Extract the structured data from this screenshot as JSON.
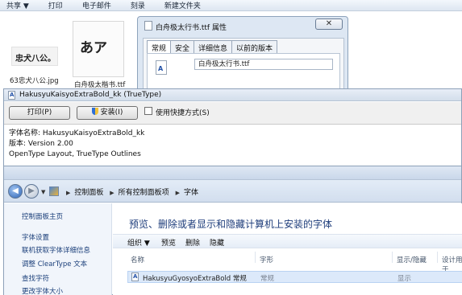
{
  "explorer": {
    "toolbar": [
      "共享 ▼",
      "打印",
      "电子邮件",
      "刻录",
      "新建文件夹"
    ],
    "files": [
      {
        "name": "63忠犬八公.jpg",
        "thumb_text": "忠犬八公。"
      },
      {
        "name": "白舟极太楷书.ttf",
        "thumb_text": "あア"
      }
    ]
  },
  "properties_dialog": {
    "title": "白舟极太行书.ttf 属性",
    "close": "✕",
    "tabs": [
      "常规",
      "安全",
      "详细信息",
      "以前的版本"
    ],
    "active_tab": "常规",
    "file_name": "白舟极太行书.ttf",
    "icon_glyph": "A"
  },
  "font_viewer": {
    "title": "HakusyuKaisyoExtraBold_kk (TrueType)",
    "print_button": "打印(P)",
    "install_button": "安装(I)",
    "shortcut_checkbox": "使用快捷方式(S)",
    "info": [
      "字体名称: HakusyuKaisyoExtraBold_kk",
      "版本: Version 2.00",
      "OpenType Layout, TrueType Outlines"
    ]
  },
  "control_panel": {
    "breadcrumb": [
      "控制面板",
      "所有控制面板项",
      "字体"
    ],
    "sidebar": [
      "控制面板主页",
      "字体设置",
      "联机获取字体详细信息",
      "调整 ClearType 文本",
      "查找字符",
      "更改字体大小"
    ],
    "heading": "预览、删除或者显示和隐藏计算机上安装的字体",
    "commands": [
      "组织 ▼",
      "预览",
      "删除",
      "隐藏"
    ],
    "columns": [
      "名称",
      "字形",
      "显示/隐藏",
      "设计用于"
    ],
    "rows": [
      {
        "name": "HakusyuGyosyoExtraBold 常规",
        "style": "常规",
        "visibility": "显示"
      }
    ]
  }
}
